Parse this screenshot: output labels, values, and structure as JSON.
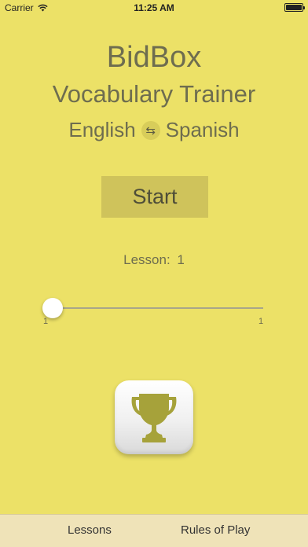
{
  "status_bar": {
    "carrier": "Carrier",
    "time": "11:25 AM"
  },
  "app": {
    "title": "BidBox",
    "subtitle": "Vocabulary Trainer",
    "language_from": "English",
    "language_to": "Spanish",
    "swap_symbol": "⇆"
  },
  "start_label": "Start",
  "lesson": {
    "label": "Lesson:",
    "value": "1",
    "slider_min": "1",
    "slider_max": "1",
    "slider_fraction": 0
  },
  "trophy": {
    "icon": "trophy-icon",
    "color": "#a6a23a"
  },
  "tabs": [
    {
      "label": "Lessons"
    },
    {
      "label": "Rules of Play"
    }
  ],
  "colors": {
    "background": "#ece167",
    "start_button": "#cfc35b",
    "tab_bar": "#efe3b8"
  }
}
